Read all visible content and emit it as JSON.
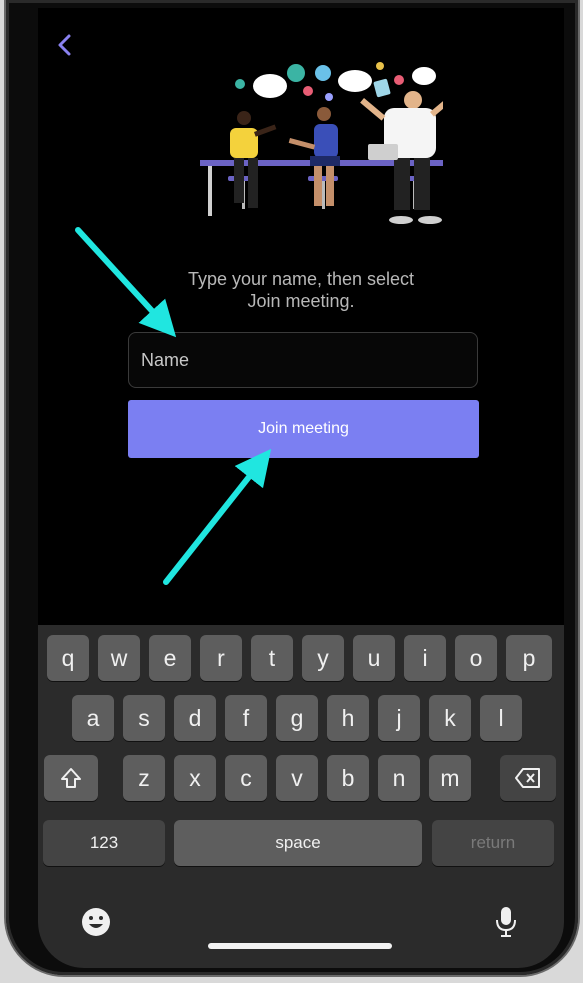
{
  "colors": {
    "accent": "#7b7ff2",
    "arrow": "#20e6e0",
    "screen_bg": "#000000",
    "keyboard_bg": "#2b2b2b"
  },
  "header": {
    "back_icon": "chevron-left-icon"
  },
  "illustration": {
    "name": "meeting-people-illustration"
  },
  "prompt": {
    "line1": "Type your name, then select",
    "line2": "Join meeting."
  },
  "form": {
    "name_placeholder": "Name",
    "name_value": "",
    "join_label": "Join meeting"
  },
  "keyboard": {
    "row1": [
      "q",
      "w",
      "e",
      "r",
      "t",
      "y",
      "u",
      "i",
      "o",
      "p"
    ],
    "row2": [
      "a",
      "s",
      "d",
      "f",
      "g",
      "h",
      "j",
      "k",
      "l"
    ],
    "row3": [
      "z",
      "x",
      "c",
      "v",
      "b",
      "n",
      "m"
    ],
    "shift_icon": "shift-icon",
    "delete_icon": "backspace-icon",
    "numbers_label": "123",
    "space_label": "space",
    "return_label": "return",
    "emoji_icon": "emoji-icon",
    "mic_icon": "microphone-icon"
  }
}
